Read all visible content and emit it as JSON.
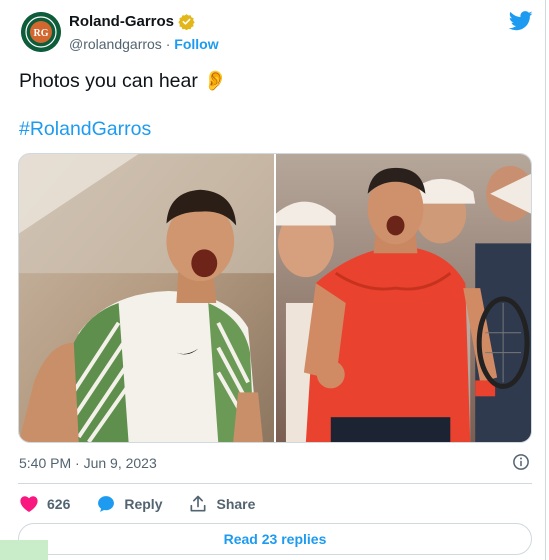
{
  "account": {
    "name": "Roland-Garros",
    "handle": "@rolandgarros",
    "separator": "·",
    "follow_label": "Follow",
    "avatar_icon": "roland-garros-logo-icon",
    "verified_icon": "verified-gold-badge-icon"
  },
  "tweet": {
    "text": "Photos you can hear",
    "emoji": "👂",
    "hashtag": "#RolandGarros",
    "timestamp": "5:40 PM · Jun 9, 2023"
  },
  "actions": {
    "like_count": "626",
    "reply_label": "Reply",
    "share_label": "Share",
    "read_replies_label": "Read 23 replies"
  },
  "colors": {
    "accent": "#1d9bf0",
    "like": "#f91880",
    "brand_green": "#0d5c3a",
    "verified_gold": "#e2b719"
  }
}
